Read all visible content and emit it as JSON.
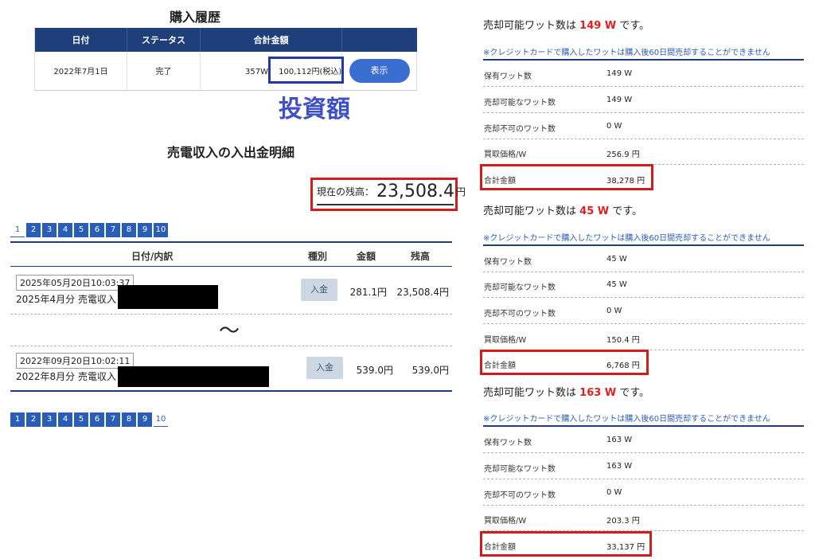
{
  "purchase_history": {
    "title": "購入履歴",
    "headers": [
      "日付",
      "ステータス",
      "合計金額",
      ""
    ],
    "row": {
      "date": "2022年7月1日",
      "status": "完了",
      "watts": "357W",
      "amount": "100,112円(税込)",
      "button": "表示"
    },
    "annotation": "投資額"
  },
  "income": {
    "title": "売電収入の入出金明細",
    "balance_label": "現在の残高：",
    "balance_value": "23,508.4",
    "balance_unit": "円",
    "pager_top": [
      "1",
      "2",
      "3",
      "4",
      "5",
      "6",
      "7",
      "8",
      "9",
      "10"
    ],
    "pager_top_current": "1",
    "pager_bottom": [
      "1",
      "2",
      "3",
      "4",
      "5",
      "6",
      "7",
      "8",
      "9",
      "10"
    ],
    "pager_bottom_current": "10",
    "headers": {
      "date": "日付/内訳",
      "type": "種別",
      "amount": "金額",
      "balance": "残高"
    },
    "rows": [
      {
        "timestamp": "2025年05月20日10:03:37",
        "desc": "2025年4月分 売電収入",
        "type": "入金",
        "amount": "281.1円",
        "balance": "23,508.4円"
      },
      {
        "timestamp": "2022年09月20日10:02:11",
        "desc": "2022年8月分 売電収入",
        "type": "入金",
        "amount": "539.0円",
        "balance": "539.0円"
      }
    ],
    "ellipsis": "〜"
  },
  "sell_panels": [
    {
      "title_prefix": "売却可能ワット数は",
      "title_num": "149 W",
      "title_suffix": "です。",
      "note": "※クレジットカードで購入したワットは購入後60日間売却することができません",
      "rows": [
        {
          "k": "保有ワット数",
          "v": "149 W"
        },
        {
          "k": "売却可能なワット数",
          "v": "149 W"
        },
        {
          "k": "売却不可のワット数",
          "v": "0 W"
        },
        {
          "k": "買取価格/W",
          "v": "256.9 円"
        },
        {
          "k": "合計金額",
          "v": "38,278 円"
        }
      ]
    },
    {
      "title_prefix": "売却可能ワット数は",
      "title_num": "45 W",
      "title_suffix": "です。",
      "note": "※クレジットカードで購入したワットは購入後60日間売却することができません",
      "rows": [
        {
          "k": "保有ワット数",
          "v": "45 W"
        },
        {
          "k": "売却可能なワット数",
          "v": "45 W"
        },
        {
          "k": "売却不可のワット数",
          "v": "0 W"
        },
        {
          "k": "買取価格/W",
          "v": "150.4 円"
        },
        {
          "k": "合計金額",
          "v": "6,768 円"
        }
      ]
    },
    {
      "title_prefix": "売却可能ワット数は",
      "title_num": "163 W",
      "title_suffix": "です。",
      "note": "※クレジットカードで購入したワットは購入後60日間売却することができません",
      "rows": [
        {
          "k": "保有ワット数",
          "v": "163 W"
        },
        {
          "k": "売却可能なワット数",
          "v": "163 W"
        },
        {
          "k": "売却不可のワット数",
          "v": "0 W"
        },
        {
          "k": "買取価格/W",
          "v": "203.3 円"
        },
        {
          "k": "合計金額",
          "v": "33,137 円"
        }
      ]
    }
  ],
  "colors": {
    "header_navy": "#1f3f7a",
    "button_blue": "#3a6ed0",
    "highlight_red": "#d21d1d",
    "annotation_blue": "#3f4fc6"
  }
}
